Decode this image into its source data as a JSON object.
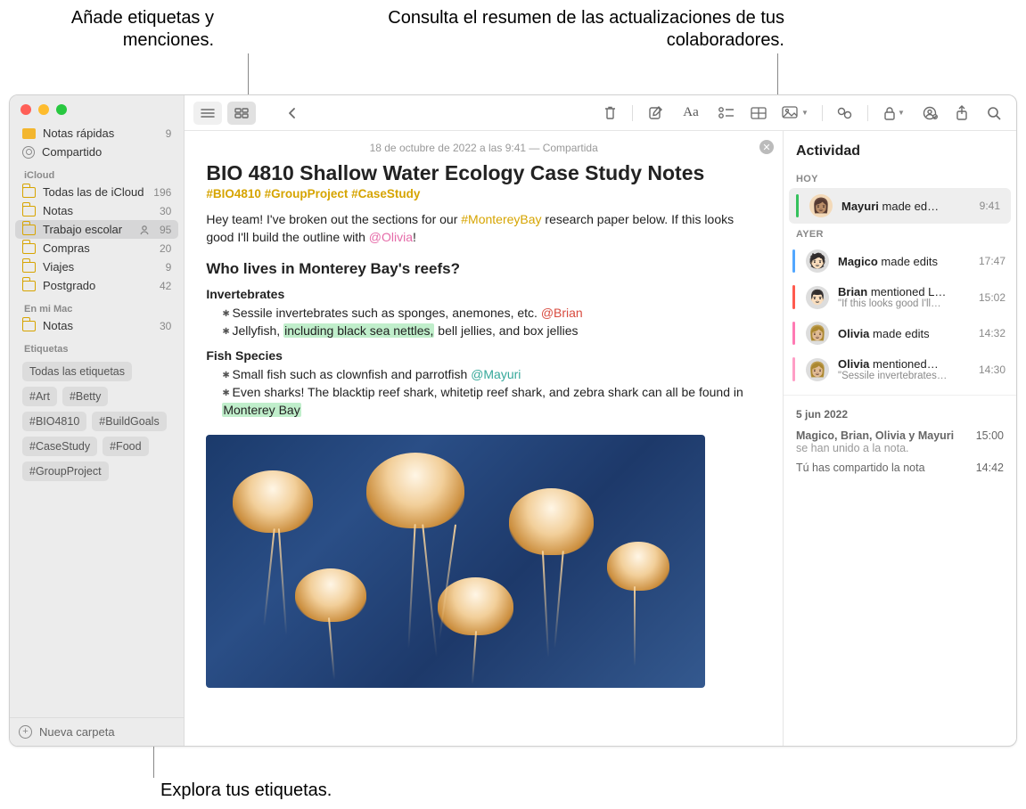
{
  "callouts": {
    "top_left": "Añade etiquetas y menciones.",
    "top_right": "Consulta el resumen de las actualizaciones de tus colaboradores.",
    "bottom_left": "Explora tus etiquetas."
  },
  "sidebar": {
    "quick_notes": {
      "label": "Notas rápidas",
      "count": "9"
    },
    "shared": {
      "label": "Compartido"
    },
    "sections": [
      {
        "header": "iCloud",
        "items": [
          {
            "label": "Todas las de iCloud",
            "count": "196"
          },
          {
            "label": "Notas",
            "count": "30"
          },
          {
            "label": "Trabajo escolar",
            "count": "95",
            "selected": true,
            "shared": true
          },
          {
            "label": "Compras",
            "count": "20"
          },
          {
            "label": "Viajes",
            "count": "9"
          },
          {
            "label": "Postgrado",
            "count": "42"
          }
        ]
      },
      {
        "header": "En mi Mac",
        "items": [
          {
            "label": "Notas",
            "count": "30"
          }
        ]
      }
    ],
    "tags_header": "Etiquetas",
    "tags": [
      "Todas las etiquetas",
      "#Art",
      "#Betty",
      "#BIO4810",
      "#BuildGoals",
      "#CaseStudy",
      "#Food",
      "#GroupProject"
    ],
    "new_folder": "Nueva carpeta"
  },
  "note": {
    "meta": "18 de octubre de 2022 a las 9:41 — Compartida",
    "title": "BIO 4810 Shallow Water Ecology Case Study Notes",
    "hashtags": "#BIO4810 #GroupProject #CaseStudy",
    "intro_a": "Hey team! I've broken out the sections for our ",
    "intro_tag": "#MontereyBay",
    "intro_b": " research paper below. If this looks good I'll build the outline with ",
    "intro_mention": "@Olivia",
    "intro_c": "!",
    "h2": "Who lives in Monterey Bay's reefs?",
    "sec1_h": "Invertebrates",
    "sec1_li1_a": "Sessile invertebrates such as sponges, anemones, etc. ",
    "sec1_li1_m": "@Brian",
    "sec1_li2_a": "Jellyfish, ",
    "sec1_li2_hl": "including black sea nettles,",
    "sec1_li2_b": " bell jellies, and box jellies",
    "sec2_h": "Fish Species",
    "sec2_li1_a": "Small fish such as clownfish and parrotfish ",
    "sec2_li1_m": "@Mayuri",
    "sec2_li2_a": "Even sharks! The blacktip reef shark, whitetip reef shark, and zebra shark can all be found in ",
    "sec2_li2_hl": "Monterey Bay"
  },
  "activity": {
    "title": "Actividad",
    "today_header": "HOY",
    "today": {
      "text_strong": "Mayuri",
      "text_rest": " made ed…",
      "time": "9:41"
    },
    "yesterday_header": "AYER",
    "yesterday": [
      {
        "bar": "blue",
        "strong": "Magico",
        "rest": " made edits",
        "time": "17:47"
      },
      {
        "bar": "red",
        "strong": "Brian",
        "rest": " mentioned L…",
        "sub": "\"If this looks good I'll…",
        "time": "15:02"
      },
      {
        "bar": "pink",
        "strong": "Olivia",
        "rest": " made edits",
        "time": "14:32"
      },
      {
        "bar": "pink2",
        "strong": "Olivia",
        "rest": " mentioned…",
        "sub": "\"Sessile invertebrates…",
        "time": "14:30"
      }
    ],
    "older_date": "5 jun 2022",
    "older": [
      {
        "text": "Magico, Brian, Olivia y Mayuri",
        "sub": "se han unido a la nota.",
        "time": "15:00"
      },
      {
        "text": "Tú has compartido la nota",
        "time": "14:42"
      }
    ]
  }
}
